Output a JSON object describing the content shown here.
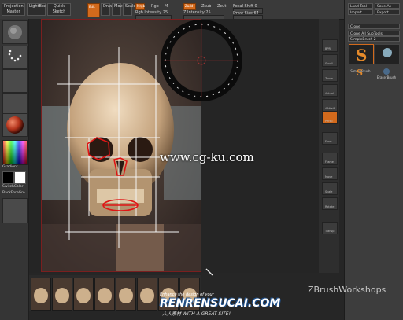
{
  "top_bar": {
    "projection_master": "Projection Master",
    "lightbox": "LightBox",
    "quick_sketch": "Quick Sketch",
    "edit": "Edit",
    "draw": "Draw",
    "move": "Move",
    "scale": "Scale",
    "rotate": "Rotate",
    "mrgb": "Mrgb",
    "rgb": "Rgb",
    "m": "M",
    "rgb_intensity": "Rgb Intensity 25",
    "zadd": "Zadd",
    "zsub": "Zsub",
    "zcut": "Zcut",
    "z_intensity": "Z Intensity 25",
    "focal_shift": "Focal Shift 0",
    "draw_size": "Draw Size 64"
  },
  "left_tray": {
    "gradient": "Gradient",
    "switch_color": "SwitchColor",
    "back_foreground": "BackForeGro"
  },
  "right_tray": {
    "load_tool": "Load Tool",
    "save_as": "Save As",
    "import": "Import",
    "export": "Export",
    "clone": "Clone",
    "clone_all_subtools": "Clone All SubTools",
    "simple_brush": "SimpleBrush 2",
    "simple_brush_label": "SimpleBrush",
    "eraser_brush": "EraserBrush",
    "r": "R"
  },
  "right_shelf": [
    "BPR",
    "Scroll",
    "Zoom",
    "Actual",
    "AAHalf",
    "Persp",
    "Floor",
    "Frame",
    "Move",
    "Scale",
    "Rotate",
    "Transp"
  ],
  "watermarks": {
    "site": "www.cg-ku.com",
    "zbrush": "ZBrushWorkshops",
    "ren_tagline": "Enhance the design of your",
    "ren_logo": "RENRENSUCAI.COM",
    "ren_sub": "人人素材  WITH A GREAT SITE!"
  },
  "colors": {
    "accent_orange": "#d36a1c",
    "annotation_red": "#e01515",
    "guide_white": "#f4f4f4"
  },
  "gyro_icons": [
    "gyro-icon"
  ],
  "filmstrip_count": 8
}
